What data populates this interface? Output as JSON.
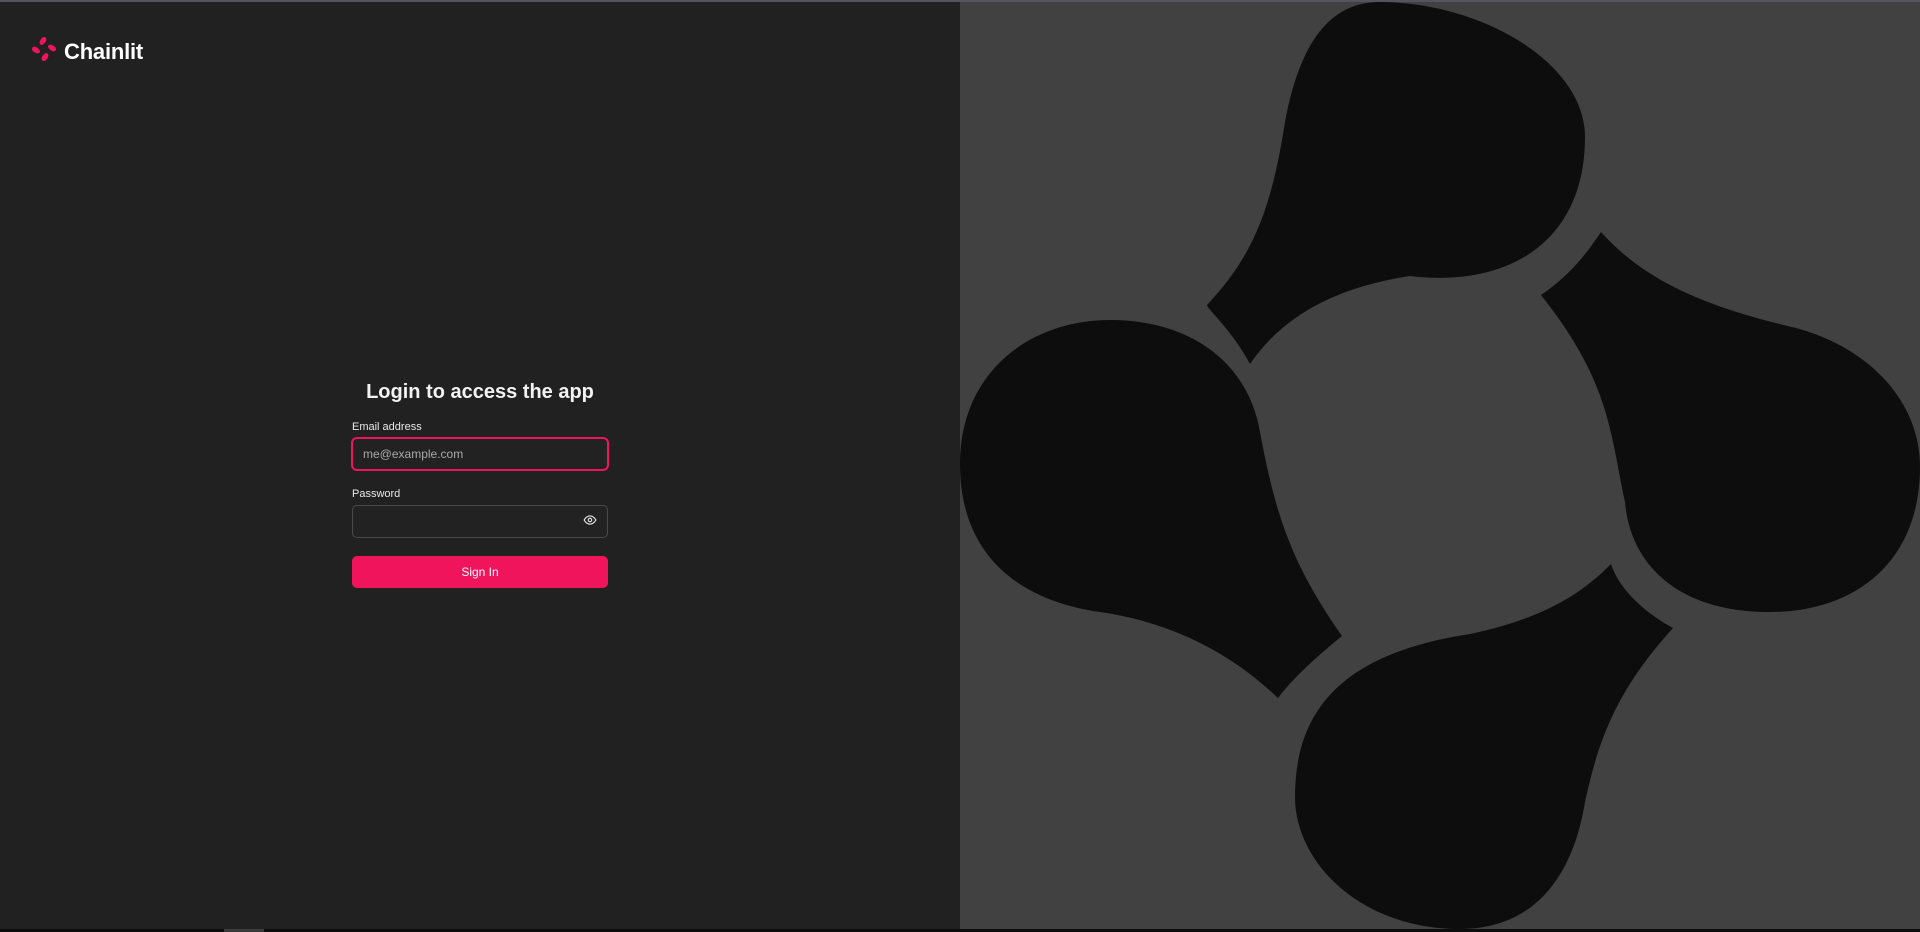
{
  "brand": {
    "name": "Chainlit",
    "logo_icon": "chainlit-logo-icon"
  },
  "login": {
    "title": "Login to access the app",
    "email": {
      "label": "Email address",
      "placeholder": "me@example.com",
      "value": ""
    },
    "password": {
      "label": "Password",
      "value": "",
      "toggle_icon": "eye-icon"
    },
    "submit_label": "Sign In"
  },
  "hero": {
    "artwork": "chainlit-logo-artwork"
  },
  "colors": {
    "accent": "#f0145d",
    "left_panel_bg": "#212121",
    "right_panel_bg": "#414141",
    "logo_shape": "#0d0d0d"
  }
}
